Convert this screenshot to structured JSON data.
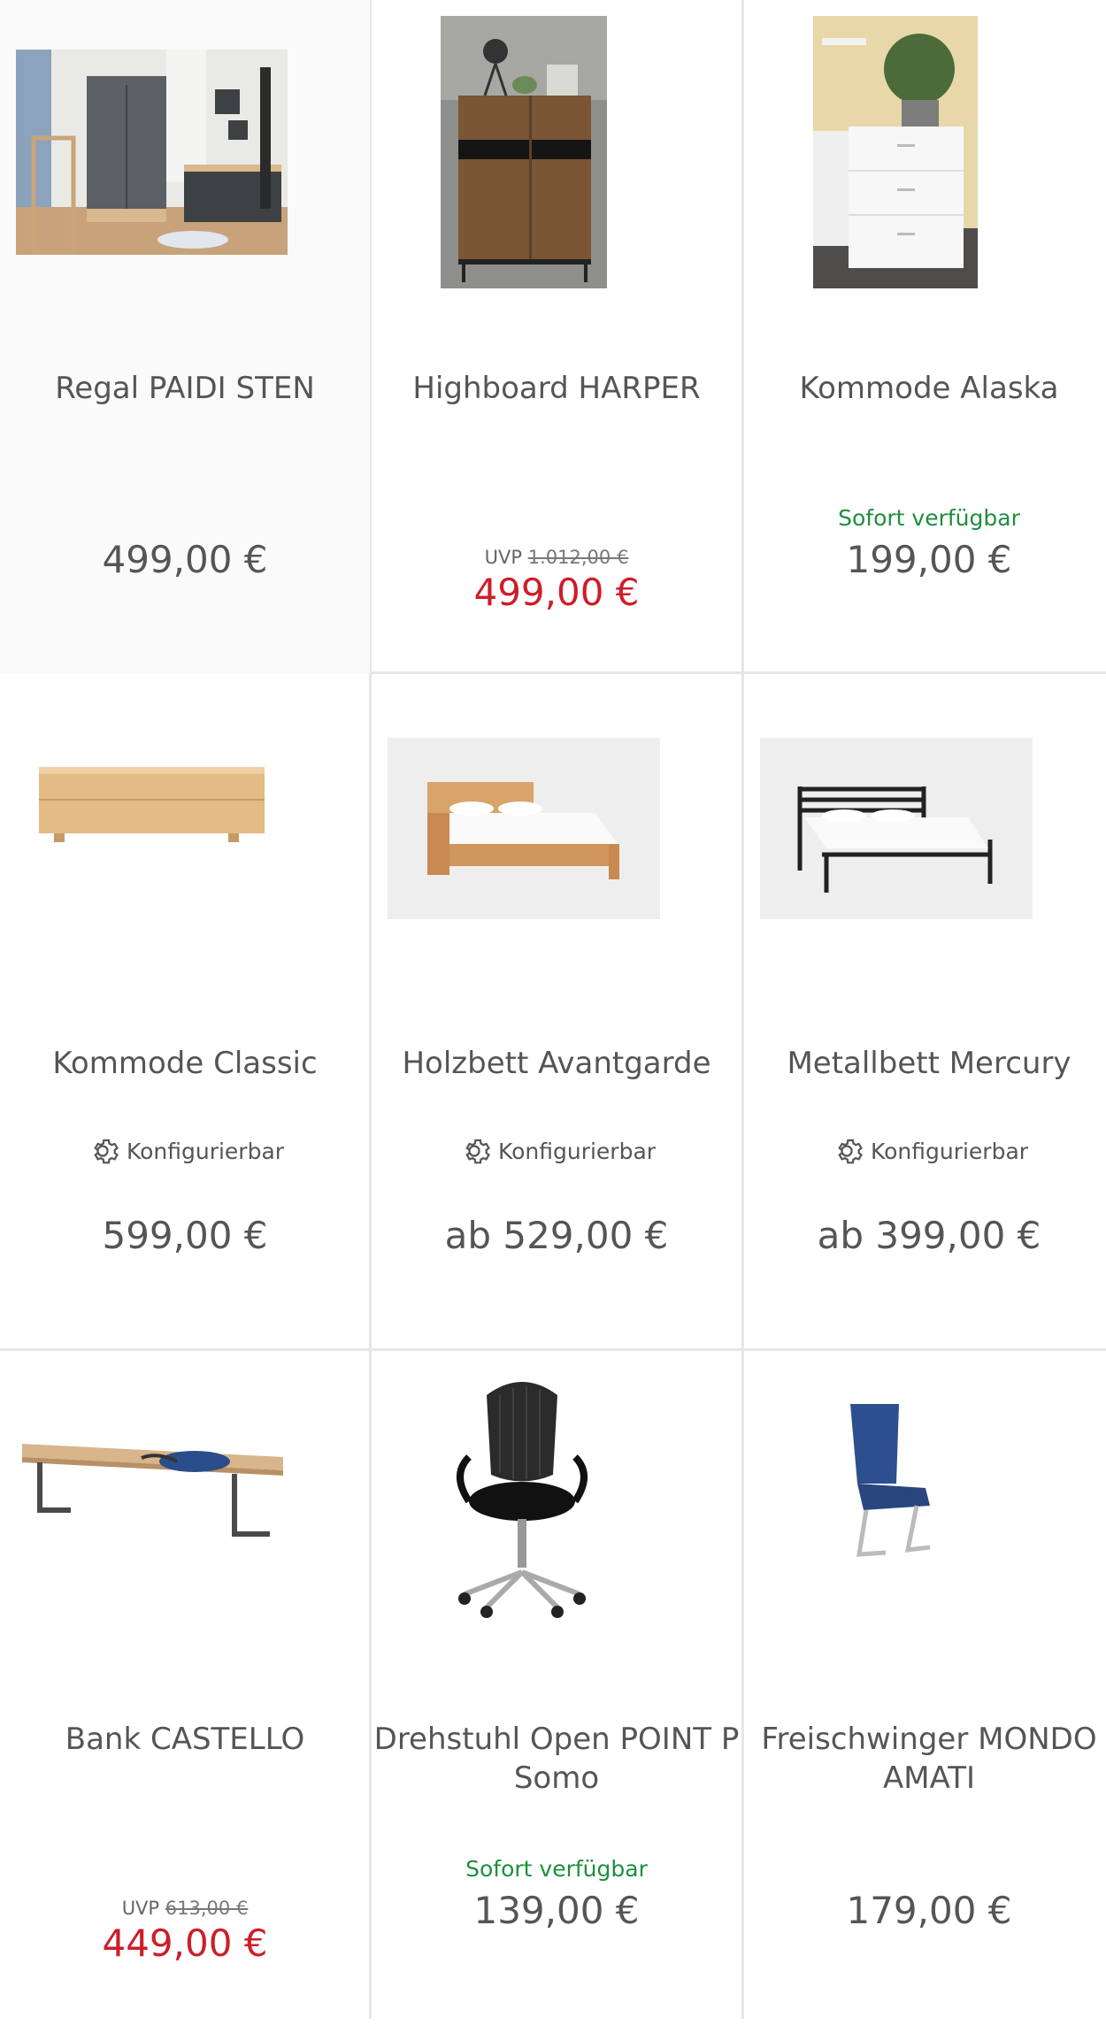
{
  "products": [
    {
      "title": "Regal PAIDI STEN",
      "price": "499,00 €",
      "image": "nursery-shelf-photo"
    },
    {
      "title": "Highboard HARPER",
      "uvp_label": "UVP",
      "uvp_price": "1.012,00 €",
      "price": "499,00 €",
      "image": "highboard-photo"
    },
    {
      "title": "Kommode Alaska",
      "availability": "Sofort verfügbar",
      "price": "199,00 €",
      "image": "white-dresser-photo"
    },
    {
      "title": "Kommode Classic",
      "config": "Konfigurierbar",
      "price": "599,00 €",
      "image": "wood-dresser-photo"
    },
    {
      "title": "Holzbett Avantgarde",
      "config": "Konfigurierbar",
      "price": "ab 529,00 €",
      "image": "wood-bed-photo"
    },
    {
      "title": "Metallbett Mercury",
      "config": "Konfigurierbar",
      "price": "ab 399,00 €",
      "image": "metal-bed-photo"
    },
    {
      "title": "Bank CASTELLO",
      "uvp_label": "UVP",
      "uvp_price": "613,00 €",
      "price": "449,00 €",
      "image": "bench-photo"
    },
    {
      "title": "Drehstuhl Open POINT P Somo",
      "availability": "Sofort verfügbar",
      "price": "139,00 €",
      "image": "office-chair-photo"
    },
    {
      "title": "Freischwinger MONDO AMATI",
      "price": "179,00 €",
      "image": "blue-chair-photo"
    }
  ],
  "colors": {
    "sale_price": "#cc1e29",
    "availability": "#1e8e3e",
    "divider": "#e6e6e6"
  }
}
